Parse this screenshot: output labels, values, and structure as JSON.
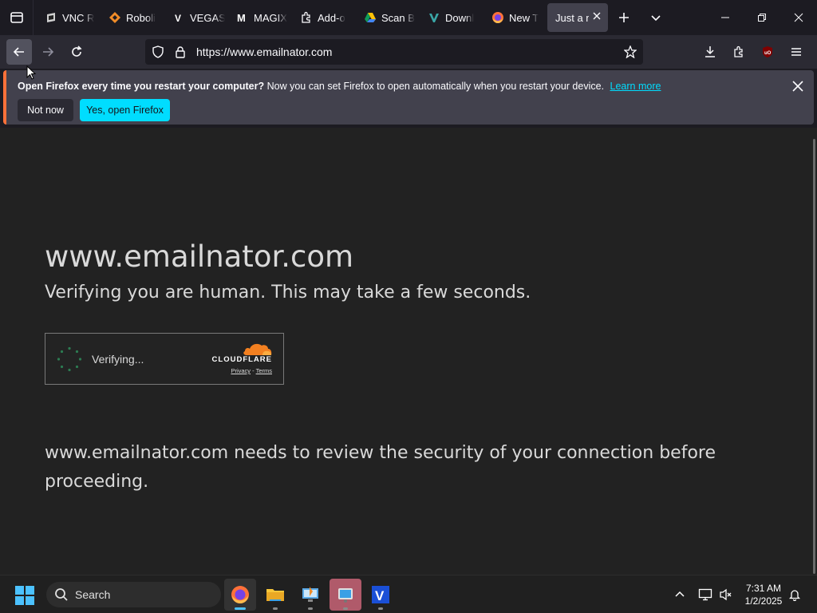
{
  "tabs": [
    {
      "label": "VNC R",
      "icon": "vnc-icon"
    },
    {
      "label": "Roboli",
      "icon": "roboli-icon"
    },
    {
      "label": "VEGAS",
      "icon": "vegas-icon"
    },
    {
      "label": "MAGIX",
      "icon": "magix-icon"
    },
    {
      "label": "Add-o",
      "icon": "puzzle-icon"
    },
    {
      "label": "Scan B",
      "icon": "google-drive-icon"
    },
    {
      "label": "Downl",
      "icon": "download-site-icon"
    },
    {
      "label": "New T",
      "icon": "firefox-icon"
    },
    {
      "label": "Just a m",
      "icon": "none",
      "active": true
    }
  ],
  "urlbar": {
    "url": "https://www.emailnator.com"
  },
  "notification": {
    "bold_text": "Open Firefox every time you restart your computer?",
    "text": "Now you can set Firefox to open automatically when you restart your device.",
    "link": "Learn more",
    "not_now": "Not now",
    "yes": "Yes, open Firefox"
  },
  "page": {
    "domain": "www.emailnator.com",
    "subtitle": "Verifying you are human. This may take a few seconds.",
    "verifying": "Verifying...",
    "cloudflare": "CLOUDFLARE",
    "privacy": "Privacy",
    "separator": "-",
    "terms": "Terms",
    "review": "www.emailnator.com needs to review the security of your connection before proceeding."
  },
  "taskbar": {
    "search_label": "Search",
    "time": "7:31 AM",
    "date": "1/2/2025",
    "apps": [
      "firefox-icon",
      "file-explorer-icon",
      "remote-desktop-icon",
      "snipping-tool-icon",
      "vegas-icon"
    ]
  },
  "colors": {
    "accent": "#00ddff",
    "notif_border": "#ff7139",
    "cloudflare_orange": "#f38020",
    "taskbar_active": "#4cc2ff"
  }
}
